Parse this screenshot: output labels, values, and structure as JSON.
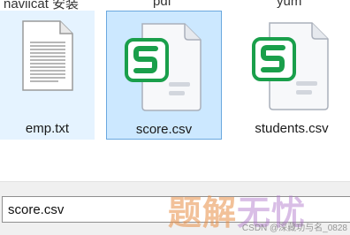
{
  "top_labels": [
    "naviicat 安装",
    "pdf",
    "yum"
  ],
  "files": [
    {
      "name": "emp.txt",
      "icon": "text-file-icon",
      "state": "hover"
    },
    {
      "name": "score.csv",
      "icon": "spreadsheet-file-icon",
      "state": "selected"
    },
    {
      "name": "students.csv",
      "icon": "spreadsheet-file-icon",
      "state": "normal"
    }
  ],
  "filename_field": {
    "value": "score.csv"
  },
  "watermark": {
    "text1": "题解",
    "text2": "无忧",
    "credit": "CSDN @深藏功与名_0828"
  },
  "colors": {
    "selected_bg": "#cce8ff",
    "hover_bg": "#e5f3ff",
    "sheet_green": "#1a9f4b"
  }
}
